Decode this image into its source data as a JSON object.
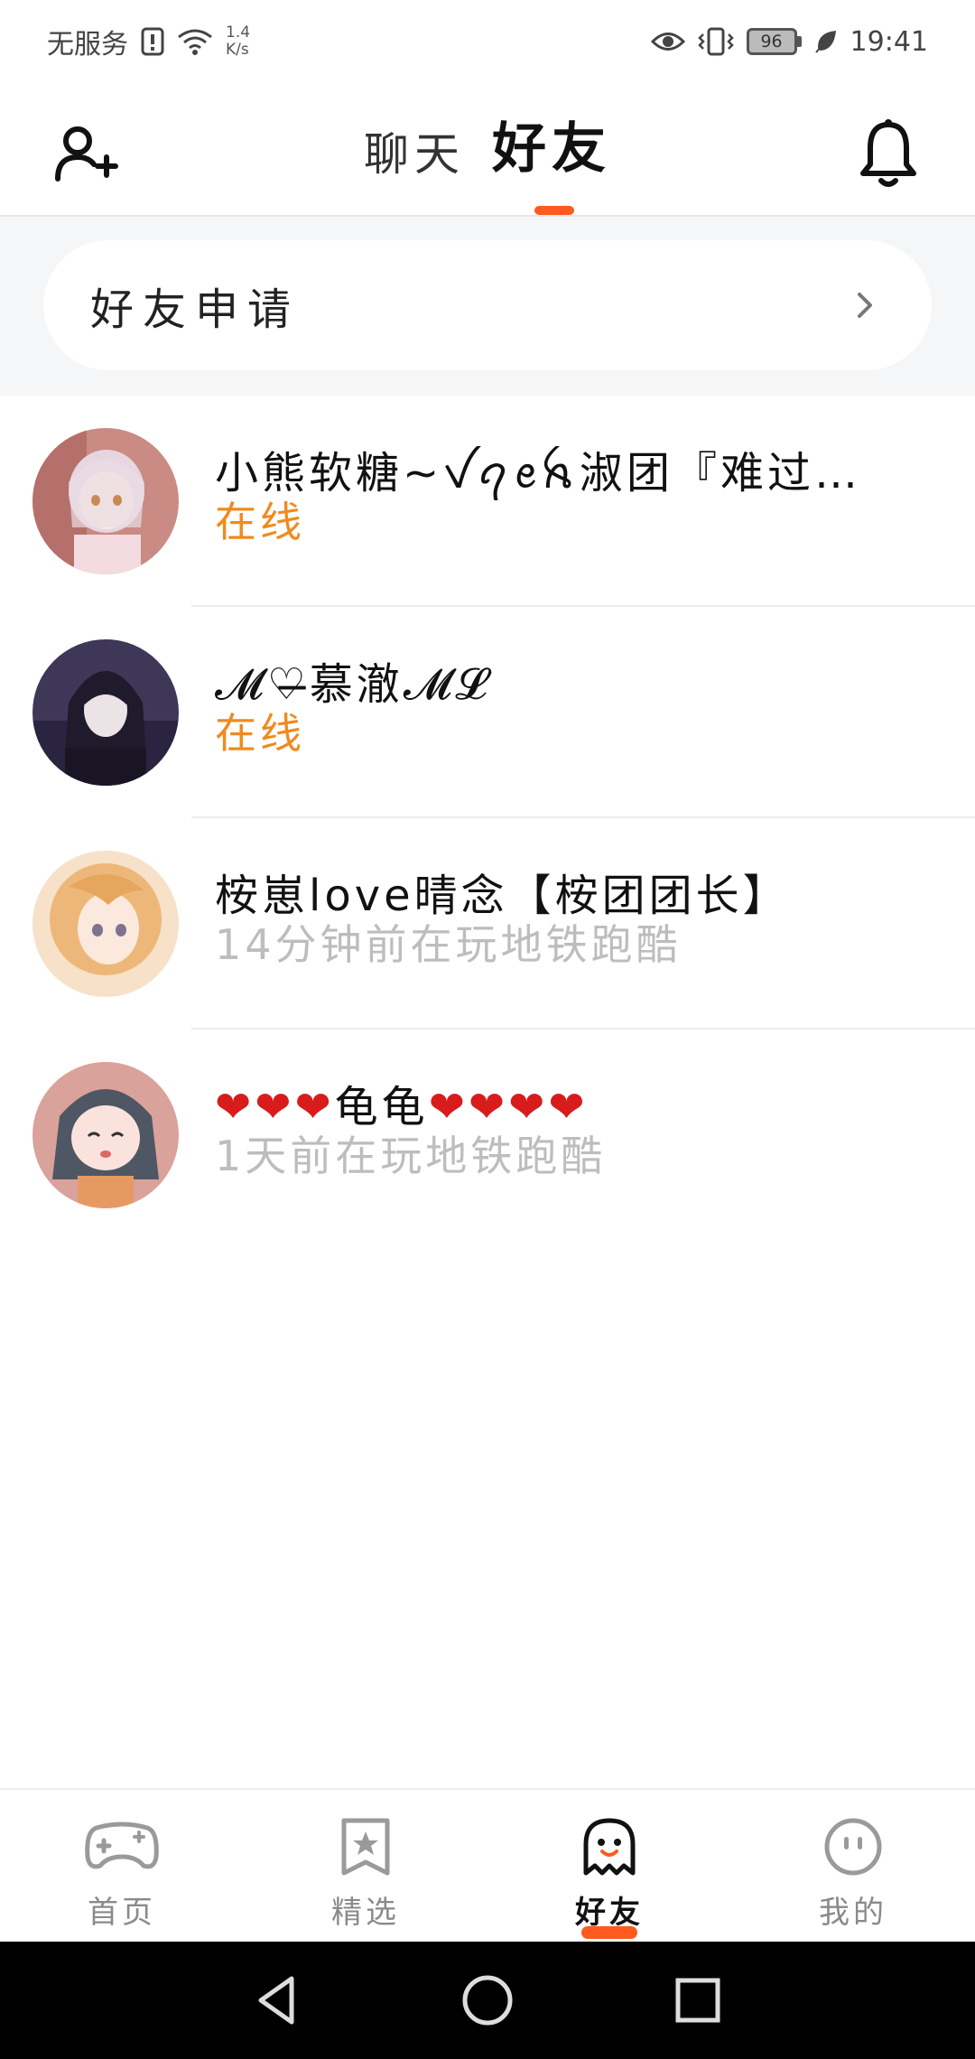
{
  "status_bar": {
    "carrier": "无服务",
    "net_speed_value": "1.4",
    "net_speed_unit": "K/s",
    "battery": "96",
    "time": "19:41"
  },
  "header": {
    "tabs": [
      {
        "label": "聊天",
        "active": false
      },
      {
        "label": "好友",
        "active": true
      }
    ],
    "accent_color": "#ff5a1f"
  },
  "friend_request": {
    "label": "好友申请"
  },
  "friends": [
    {
      "name": "小熊软糖~ꪜꪖꫀꫝ淑团『难过…",
      "status": "在线",
      "online": true
    },
    {
      "name": "𝓜♡̶慕澈𝓜𝓛",
      "status": "在线",
      "online": true
    },
    {
      "name": "桉崽love晴念【桉团团长】",
      "status": "14分钟前在玩地铁跑酷",
      "online": false
    },
    {
      "name": "❤❤❤龟龟❤❤❤❤",
      "status": "1天前在玩地铁跑酷",
      "online": false
    }
  ],
  "bottom_nav": [
    {
      "label": "首页",
      "icon": "gamepad-icon",
      "active": false
    },
    {
      "label": "精选",
      "icon": "star-bookmark-icon",
      "active": false
    },
    {
      "label": "好友",
      "icon": "ghost-icon",
      "active": true
    },
    {
      "label": "我的",
      "icon": "smiley-icon",
      "active": false
    }
  ]
}
